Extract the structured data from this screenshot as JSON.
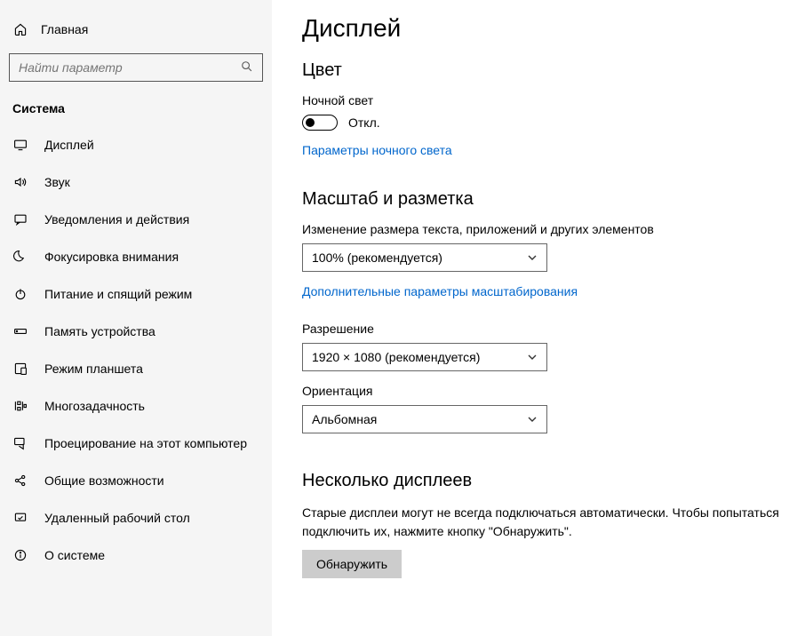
{
  "sidebar": {
    "home": "Главная",
    "search_placeholder": "Найти параметр",
    "section": "Система",
    "items": [
      {
        "label": "Дисплей"
      },
      {
        "label": "Звук"
      },
      {
        "label": "Уведомления и действия"
      },
      {
        "label": "Фокусировка внимания"
      },
      {
        "label": "Питание и спящий режим"
      },
      {
        "label": "Память устройства"
      },
      {
        "label": "Режим планшета"
      },
      {
        "label": "Многозадачность"
      },
      {
        "label": "Проецирование на этот компьютер"
      },
      {
        "label": "Общие возможности"
      },
      {
        "label": "Удаленный рабочий стол"
      },
      {
        "label": "О системе"
      }
    ]
  },
  "main": {
    "title": "Дисплей",
    "color_heading": "Цвет",
    "nightlight_label": "Ночной свет",
    "nightlight_state": "Откл.",
    "nightlight_settings_link": "Параметры ночного света",
    "scale_heading": "Масштаб и разметка",
    "scale_label": "Изменение размера текста, приложений и других элементов",
    "scale_value": "100% (рекомендуется)",
    "advanced_scaling_link": "Дополнительные параметры масштабирования",
    "resolution_label": "Разрешение",
    "resolution_value": "1920 × 1080 (рекомендуется)",
    "orientation_label": "Ориентация",
    "orientation_value": "Альбомная",
    "multi_heading": "Несколько дисплеев",
    "multi_text": "Старые дисплеи могут не всегда подключаться автоматически. Чтобы попытаться подключить их, нажмите кнопку \"Обнаружить\".",
    "detect_button": "Обнаружить"
  }
}
